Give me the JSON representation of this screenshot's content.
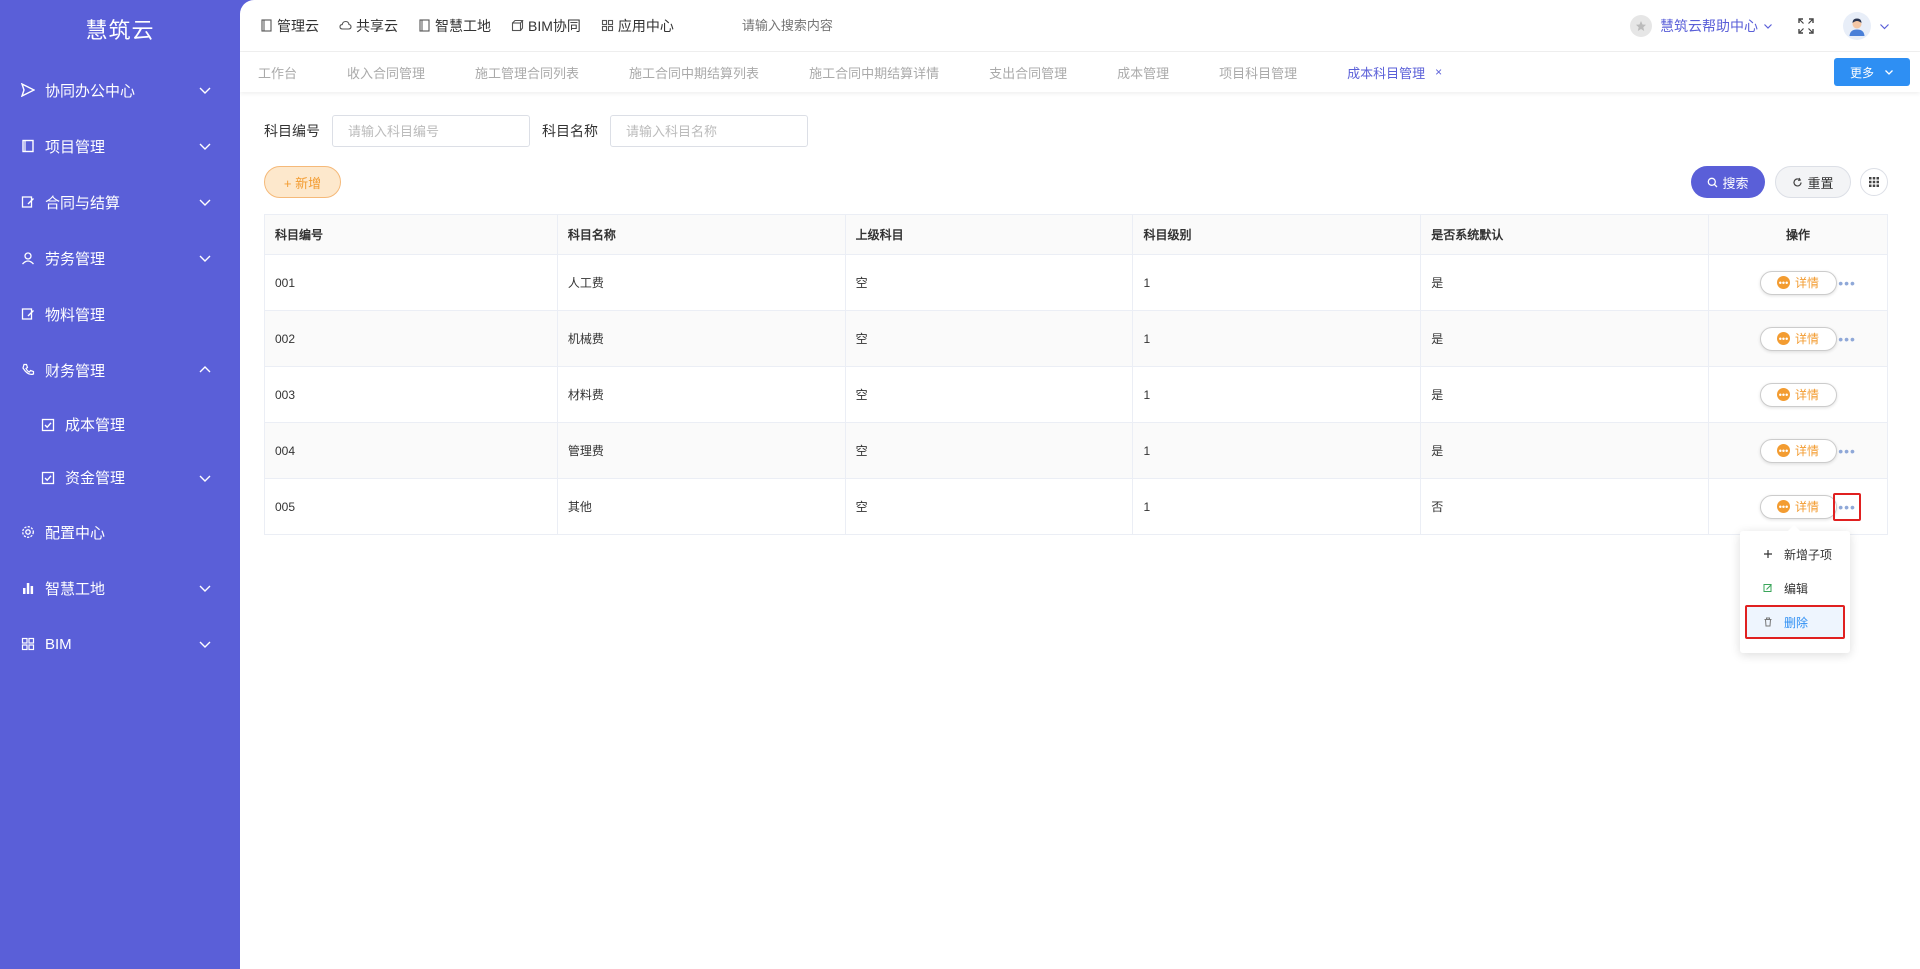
{
  "sidebar": {
    "brand": "慧筑云",
    "items": [
      {
        "label": "协同办公中心",
        "icon": "send-icon"
      },
      {
        "label": "项目管理",
        "icon": "book-icon"
      },
      {
        "label": "合同与结算",
        "icon": "edit-icon"
      },
      {
        "label": "劳务管理",
        "icon": "worker-icon"
      },
      {
        "label": "物料管理",
        "icon": "edit-icon"
      },
      {
        "label": "财务管理",
        "icon": "phone-icon"
      },
      {
        "label": "成本管理",
        "icon": "checkbox-icon"
      },
      {
        "label": "资金管理",
        "icon": "checkbox-icon"
      },
      {
        "label": "配置中心",
        "icon": "gear-icon"
      },
      {
        "label": "智慧工地",
        "icon": "bar-chart-icon"
      },
      {
        "label": "BIM",
        "icon": "grid-icon"
      }
    ]
  },
  "topbar": {
    "links": [
      {
        "label": "管理云",
        "icon": "book-icon"
      },
      {
        "label": "共享云",
        "icon": "cloud-icon"
      },
      {
        "label": "智慧工地",
        "icon": "book-icon"
      },
      {
        "label": "BIM协同",
        "icon": "cube-icon"
      },
      {
        "label": "应用中心",
        "icon": "grid-icon"
      }
    ],
    "search_placeholder": "请输入搜索内容",
    "help_label": "慧筑云帮助中心"
  },
  "tabs": {
    "items": [
      "工作台",
      "收入合同管理",
      "施工管理合同列表",
      "施工合同中期结算列表",
      "施工合同中期结算详情",
      "支出合同管理",
      "成本管理",
      "项目科目管理",
      "成本科目管理"
    ],
    "close": "×",
    "more_label": "更多"
  },
  "filters": {
    "code_label": "科目编号",
    "code_placeholder": "请输入科目编号",
    "name_label": "科目名称",
    "name_placeholder": "请输入科目名称"
  },
  "actions": {
    "add_label": "+ 新增",
    "search_label": "搜索",
    "reset_label": "重置"
  },
  "table": {
    "headers": [
      "科目编号",
      "科目名称",
      "上级科目",
      "科目级别",
      "是否系统默认",
      "操作"
    ],
    "rows": [
      [
        "001",
        "人工费",
        "空",
        "1",
        "是"
      ],
      [
        "002",
        "机械费",
        "空",
        "1",
        "是"
      ],
      [
        "003",
        "材料费",
        "空",
        "1",
        "是"
      ],
      [
        "004",
        "管理费",
        "空",
        "1",
        "是"
      ],
      [
        "005",
        "其他",
        "空",
        "1",
        "否"
      ]
    ],
    "detail_label": "详情",
    "more_dots": "•••"
  },
  "dropdown": {
    "items": [
      {
        "label": "新增子项",
        "icon": "plus-icon"
      },
      {
        "label": "编辑",
        "icon": "edit-icon"
      },
      {
        "label": "删除",
        "icon": "trash-icon"
      }
    ]
  },
  "colors": {
    "primary": "#5a5fd8",
    "accent_blue": "#2e8ff3",
    "orange": "#f39c31",
    "highlight_red": "#e02020"
  }
}
